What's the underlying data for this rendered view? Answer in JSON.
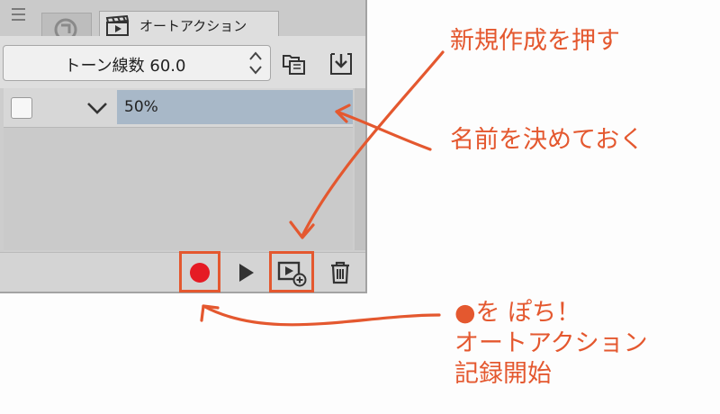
{
  "panel": {
    "tab_active_label": "オートアクション",
    "set_select": {
      "value": "トーン線数 60.0"
    },
    "action_row": {
      "name": "50%",
      "checked": false
    }
  },
  "annotations": {
    "new_note": "新規作成を押す",
    "name_note": "名前を決めておく",
    "record_note_line1": "●を ぽち！",
    "record_note_line2": "オートアクション",
    "record_note_line3": "記録開始"
  },
  "colors": {
    "annotation": "#e4582f",
    "record": "#e51b24",
    "selected_row": "#a8b8c8"
  }
}
